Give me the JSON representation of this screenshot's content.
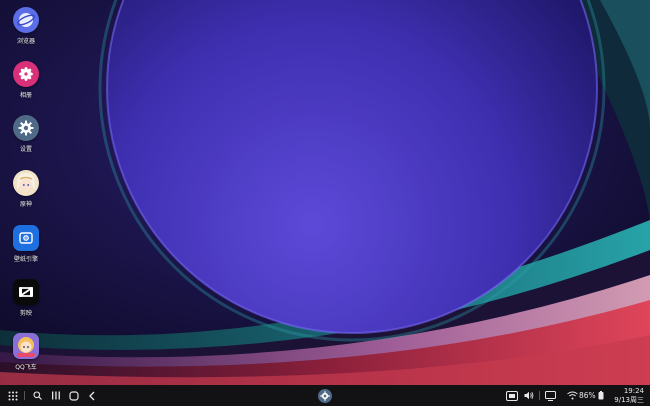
{
  "desktop": {
    "apps": [
      {
        "label": "浏览器",
        "icon": "browser-icon",
        "color": "#5b6ee8"
      },
      {
        "label": "相册",
        "icon": "gallery-icon",
        "color": "#d9307a"
      },
      {
        "label": "设置",
        "icon": "settings-icon",
        "color": "#4f6a86"
      },
      {
        "label": "原神",
        "icon": "genshin-icon",
        "color": "#f2e3c8"
      },
      {
        "label": "壁纸引擎",
        "icon": "wallpaper-engine-icon",
        "color": "#1e6fe0"
      },
      {
        "label": "剪映",
        "icon": "capcut-icon",
        "color": "#0a0a0a"
      },
      {
        "label": "QQ飞车",
        "icon": "qq-speed-icon",
        "color": "#8a6fd8"
      }
    ]
  },
  "taskbar": {
    "left_icons": [
      "apps-grid-icon",
      "search-icon",
      "recents-icon",
      "home-icon",
      "back-icon"
    ],
    "pinned_app_icon": "settings-icon",
    "tray_icons": [
      "screenshot-icon",
      "volume-icon",
      "screen-share-icon",
      "wifi-icon",
      "battery-icon"
    ],
    "battery_text": "86%",
    "time": "19:24",
    "date": "9/13周三"
  }
}
